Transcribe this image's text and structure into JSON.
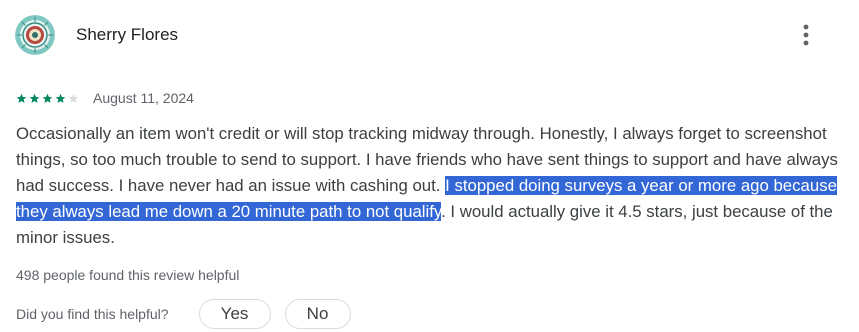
{
  "reviewer": {
    "name": "Sherry Flores",
    "avatar_icon": "circular-pattern-avatar-icon"
  },
  "menu": {
    "more_icon": "more-vert-icon"
  },
  "rating": {
    "stars_filled": 4,
    "stars_total": 5,
    "star_color": "#01875f",
    "star_empty_color": "#dadce0",
    "date": "August 11, 2024"
  },
  "review": {
    "text_before_selection": "Occasionally an item won't credit or will stop tracking midway through. Honestly, I always forget to screenshot things, so too much trouble to send to support. I have friends who have sent things to support and have always had success. I have never had an issue with cashing out. ",
    "text_selected": "I stopped doing surveys a year or more ago because they always lead me down a 20 minute path to not qualify",
    "text_after_selection": ". I would actually give it 4.5 stars, just because of the minor issues.",
    "selection_color": "#3367d6"
  },
  "helpful": {
    "count_text": "498 people found this review helpful",
    "question": "Did you find this helpful?",
    "yes_label": "Yes",
    "no_label": "No"
  }
}
